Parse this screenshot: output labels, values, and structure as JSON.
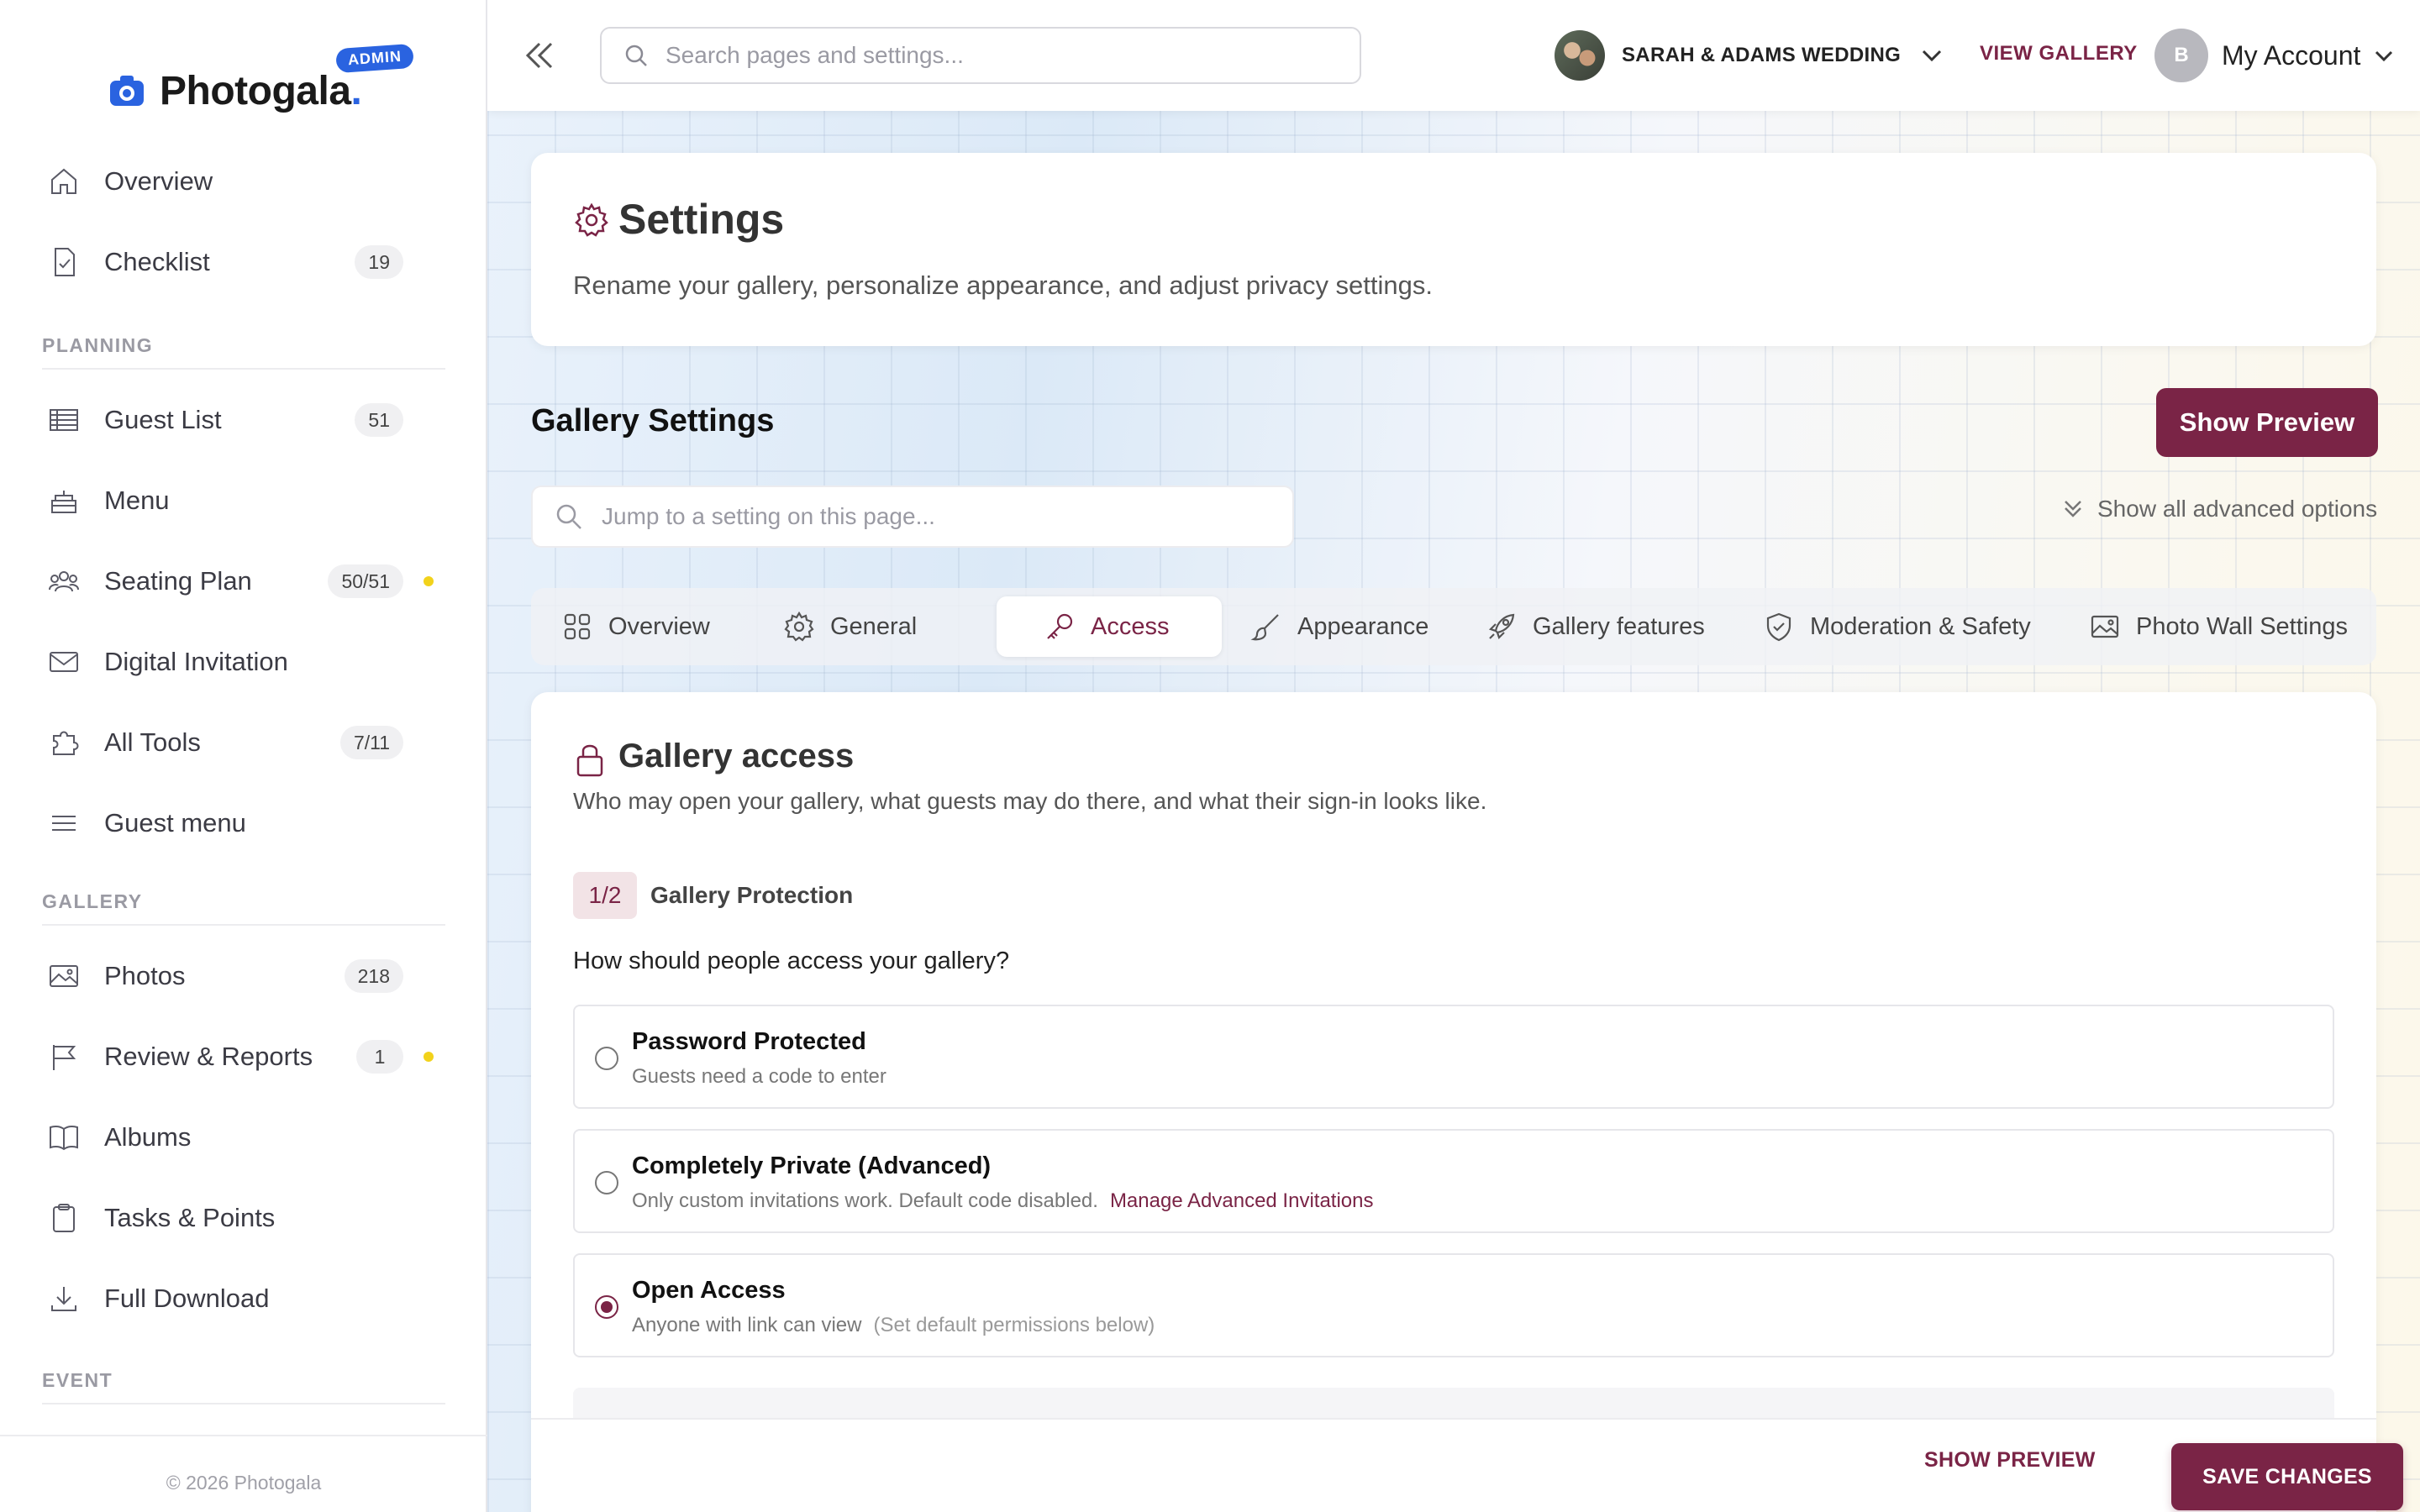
{
  "brand": {
    "name": "Photogala",
    "dot": ".",
    "badge": "ADMIN"
  },
  "sidebar": {
    "top_items": [
      {
        "label": "Overview",
        "icon": "home-icon"
      },
      {
        "label": "Checklist",
        "icon": "checklist-icon",
        "count": "19"
      }
    ],
    "sections": {
      "planning": "PLANNING",
      "gallery": "GALLERY",
      "event": "EVENT"
    },
    "planning_items": [
      {
        "label": "Guest List",
        "icon": "table-icon",
        "count": "51"
      },
      {
        "label": "Menu",
        "icon": "cake-icon"
      },
      {
        "label": "Seating Plan",
        "icon": "people-icon",
        "count": "50/51",
        "dot": true
      },
      {
        "label": "Digital Invitation",
        "icon": "mail-icon"
      },
      {
        "label": "All Tools",
        "icon": "puzzle-icon",
        "count": "7/11"
      },
      {
        "label": "Guest menu",
        "icon": "menu-icon"
      }
    ],
    "gallery_items": [
      {
        "label": "Photos",
        "icon": "image-icon",
        "count": "218"
      },
      {
        "label": "Review & Reports",
        "icon": "flag-icon",
        "count": "1",
        "dot": true
      },
      {
        "label": "Albums",
        "icon": "book-icon"
      },
      {
        "label": "Tasks & Points",
        "icon": "clipboard-icon"
      },
      {
        "label": "Full Download",
        "icon": "download-icon"
      }
    ],
    "copyright": "© 2026 Photogala"
  },
  "topbar": {
    "search_placeholder": "Search pages and settings...",
    "event_name": "SARAH & ADAMS WEDDING",
    "view_gallery": "VIEW GALLERY",
    "account_initial": "B",
    "account_label": "My Account"
  },
  "settings": {
    "title": "Settings",
    "subtitle": "Rename your gallery, personalize appearance, and adjust privacy settings."
  },
  "gallery_settings": {
    "heading": "Gallery Settings",
    "show_preview": "Show Preview",
    "jump_placeholder": "Jump to a setting on this page...",
    "advanced_toggle": "Show all advanced options",
    "tabs": [
      {
        "label": "Overview",
        "icon": "grid-icon"
      },
      {
        "label": "General",
        "icon": "gear-icon"
      },
      {
        "label": "Access",
        "icon": "key-icon",
        "active": true
      },
      {
        "label": "Appearance",
        "icon": "brush-icon"
      },
      {
        "label": "Gallery features",
        "icon": "rocket-icon"
      },
      {
        "label": "Moderation & Safety",
        "icon": "shield-icon"
      },
      {
        "label": "Photo Wall Settings",
        "icon": "picture-icon"
      }
    ]
  },
  "access": {
    "title": "Gallery access",
    "subtitle": "Who may open your gallery, what guests may do there, and what their sign-in looks like.",
    "step": "1/2",
    "step_label": "Gallery Protection",
    "question": "How should people access your gallery?",
    "options": [
      {
        "title": "Password Protected",
        "desc": "Guests need a code to enter",
        "checked": false
      },
      {
        "title": "Completely Private (Advanced)",
        "desc": "Only custom invitations work. Default code disabled.",
        "link": "Manage Advanced Invitations",
        "checked": false
      },
      {
        "title": "Open Access",
        "desc": "Anyone with link can view",
        "hint": "(Set default permissions below)",
        "checked": true
      }
    ]
  },
  "footer_actions": {
    "show_preview": "SHOW PREVIEW",
    "save": "SAVE CHANGES"
  },
  "colors": {
    "accent": "#7a2446",
    "brand_blue": "#2a63e0",
    "status_dot": "#f2d21b"
  }
}
